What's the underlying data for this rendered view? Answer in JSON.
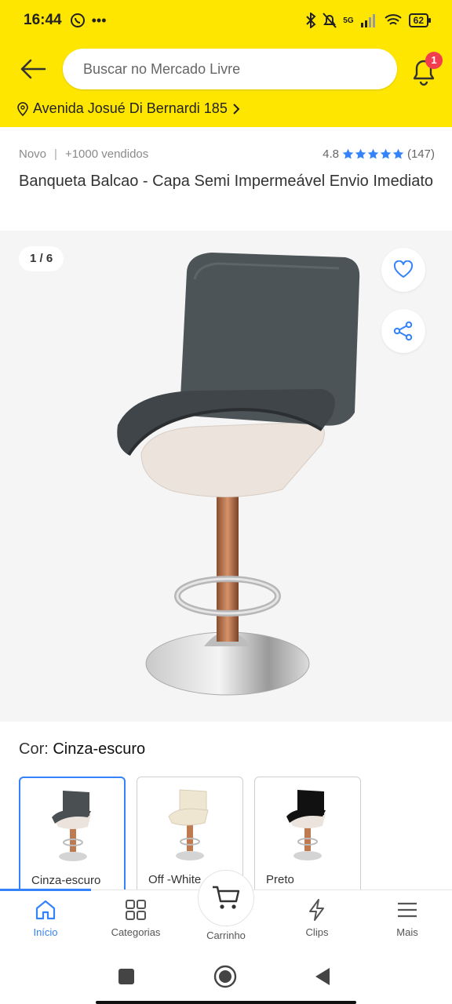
{
  "status_bar": {
    "time": "16:44",
    "network": "5G",
    "battery": "62"
  },
  "header": {
    "search_placeholder": "Buscar no Mercado Livre",
    "notification_count": "1",
    "address": "Avenida Josué Di Bernardi 185"
  },
  "product": {
    "condition": "Novo",
    "sold": "+1000 vendidos",
    "rating": "4.8",
    "rating_stars": 5,
    "review_count": "(147)",
    "title": " Banqueta Balcao  - Capa Semi Impermeável Envio Imediato"
  },
  "gallery": {
    "counter": "1 / 6"
  },
  "color": {
    "label": "Cor:",
    "selected": "Cinza-escuro",
    "options": [
      {
        "label": "Cinza-escuro",
        "seat_color": "#4a4f52"
      },
      {
        "label": "Off -White",
        "seat_color": "#efe6d2"
      },
      {
        "label": "Preto",
        "seat_color": "#111111"
      }
    ]
  },
  "bottom_nav": {
    "items": [
      {
        "label": "Início",
        "icon": "home-icon"
      },
      {
        "label": "Categorias",
        "icon": "grid-icon"
      },
      {
        "label": "Carrinho",
        "icon": "cart-icon"
      },
      {
        "label": "Clips",
        "icon": "lightning-icon"
      },
      {
        "label": "Mais",
        "icon": "menu-icon"
      }
    ]
  },
  "colors": {
    "brand_yellow": "#ffe600",
    "accent_blue": "#3483fa",
    "badge_red": "#f23d4f"
  }
}
